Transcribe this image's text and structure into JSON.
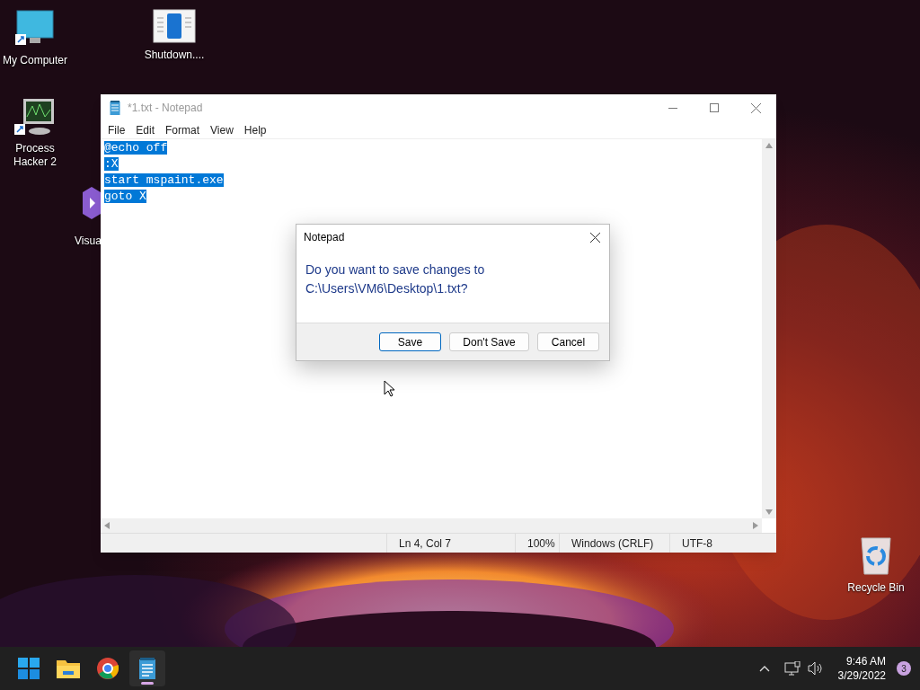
{
  "desktop_icons": [
    {
      "kind": "computer",
      "label": "My Computer"
    },
    {
      "kind": "document",
      "label": "Shutdown...."
    },
    {
      "kind": "monitor",
      "label": "Process Hacker 2"
    },
    {
      "kind": "studio",
      "label": "Visua"
    },
    {
      "kind": "recycle",
      "label": "Recycle Bin"
    }
  ],
  "notepad": {
    "title": "*1.txt - Notepad",
    "menu": [
      "File",
      "Edit",
      "Format",
      "View",
      "Help"
    ],
    "lines": [
      {
        "text": "@echo off",
        "selected": true
      },
      {
        "text": ":X",
        "selected": true
      },
      {
        "text": "start mspaint.exe",
        "selected": true
      },
      {
        "text": "goto X",
        "selected": true
      }
    ],
    "status_bar": [
      "Ln 4, Col 7",
      "100%",
      "Windows (CRLF)",
      "UTF-8"
    ]
  },
  "dialog": {
    "title": "Notepad",
    "message": "Do you want to save changes to C:\\Users\\VM6\\Desktop\\1.txt?",
    "buttons": [
      {
        "label": "Save",
        "selected": true
      },
      {
        "label": "Don't Save",
        "selected": false
      },
      {
        "label": "Cancel",
        "selected": false
      }
    ]
  },
  "taskbar": {
    "apps": [
      {
        "kind": "start",
        "selected": false
      },
      {
        "kind": "folder",
        "selected": false
      },
      {
        "kind": "browser",
        "selected": false
      },
      {
        "kind": "notepad",
        "selected": true
      }
    ],
    "time": "9:46 AM",
    "date": "3/29/2022",
    "notification_count": "3"
  }
}
